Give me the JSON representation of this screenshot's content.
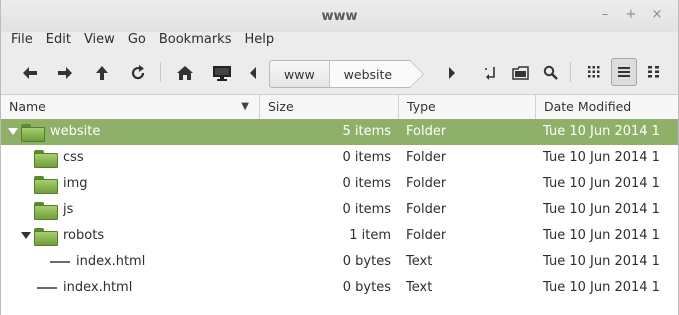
{
  "window": {
    "title": "www",
    "controls": [
      "–",
      "+",
      "×"
    ]
  },
  "menubar": [
    "File",
    "Edit",
    "View",
    "Go",
    "Bookmarks",
    "Help"
  ],
  "toolbar": {
    "icons": [
      "back-icon",
      "forward-icon",
      "up-icon",
      "reload-icon",
      "home-icon",
      "computer-icon"
    ],
    "breadcrumb": [
      "www",
      "website"
    ],
    "right_icons": [
      "open-terminal-icon",
      "new-folder-icon",
      "search-icon"
    ],
    "views": [
      "icon-view",
      "list-view",
      "compact-view"
    ],
    "active_view": "list-view"
  },
  "columns": {
    "name": "Name",
    "size": "Size",
    "type": "Type",
    "date": "Date Modified"
  },
  "rows": [
    {
      "name": "website",
      "size": "5 items",
      "type": "Folder",
      "date": "Tue 10 Jun 2014 1",
      "kind": "folder",
      "depth": 0,
      "expanded": true,
      "selected": true
    },
    {
      "name": "css",
      "size": "0 items",
      "type": "Folder",
      "date": "Tue 10 Jun 2014 1",
      "kind": "folder",
      "depth": 1
    },
    {
      "name": "img",
      "size": "0 items",
      "type": "Folder",
      "date": "Tue 10 Jun 2014 1",
      "kind": "folder",
      "depth": 1
    },
    {
      "name": "js",
      "size": "0 items",
      "type": "Folder",
      "date": "Tue 10 Jun 2014 1",
      "kind": "folder",
      "depth": 1
    },
    {
      "name": "robots",
      "size": "1 item",
      "type": "Folder",
      "date": "Tue 10 Jun 2014 1",
      "kind": "folder",
      "depth": 1,
      "expanded": true
    },
    {
      "name": "index.html",
      "size": "0 bytes",
      "type": "Text",
      "date": "Tue 10 Jun 2014 1",
      "kind": "file",
      "depth": 2
    },
    {
      "name": "index.html",
      "size": "0 bytes",
      "type": "Text",
      "date": "Tue 10 Jun 2014 1",
      "kind": "file",
      "depth": 1
    }
  ],
  "colors": {
    "selection": "#8fb069",
    "folder": "#8bbd52"
  }
}
